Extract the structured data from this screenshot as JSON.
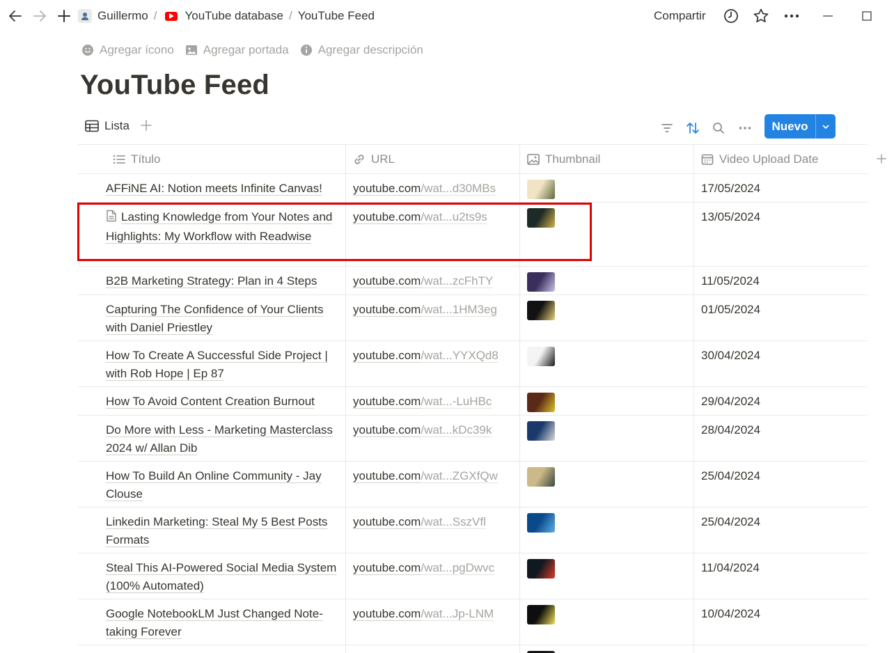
{
  "breadcrumb": {
    "user": "Guillermo",
    "sep": "/",
    "database": "YouTube database",
    "page": "YouTube Feed"
  },
  "topbar": {
    "share": "Compartir"
  },
  "page_actions": {
    "add_icon": "Agregar ícono",
    "add_cover": "Agregar portada",
    "add_description": "Agregar descripción"
  },
  "title": "YouTube Feed",
  "view": {
    "tab_label": "Lista",
    "new_label": "Nuevo"
  },
  "columns": {
    "title": "Título",
    "url": "URL",
    "thumbnail": "Thumbnail",
    "date": "Video Upload Date"
  },
  "colors": {
    "accent": "#2383e2",
    "highlight": "#e00000"
  },
  "rows": [
    {
      "title": "AFFiNE AI: Notion meets Infinite Canvas!",
      "url_main": "youtube.com",
      "url_rest": "/wat...d30MBs",
      "date": "17/05/2024",
      "thumb_a": "#f2e3c4",
      "thumb_b": "#5a6b3c"
    },
    {
      "title": "Lasting Knowledge from Your Notes and Highlights: My Workflow with Readwise",
      "url_main": "youtube.com",
      "url_rest": "/wat...u2ts9s",
      "date": "13/05/2024",
      "thumb_a": "#1e2a26",
      "thumb_b": "#d4b44a"
    },
    {
      "title": "B2B Marketing Strategy: Plan in 4 Steps",
      "url_main": "youtube.com",
      "url_rest": "/wat...zcFhTY",
      "date": "11/05/2024",
      "thumb_a": "#3a2f5c",
      "thumb_b": "#c9c4e8"
    },
    {
      "title": "Capturing The Confidence of Your Clients with Daniel Priestley",
      "url_main": "youtube.com",
      "url_rest": "/wat...1HM3eg",
      "date": "01/05/2024",
      "thumb_a": "#121212",
      "thumb_b": "#e8d27a"
    },
    {
      "title": "How To Create A Successful Side Project | with Rob Hope | Ep 87",
      "url_main": "youtube.com",
      "url_rest": "/wat...YYXQd8",
      "date": "30/04/2024",
      "thumb_a": "#f4f4f4",
      "thumb_b": "#1a1a1a"
    },
    {
      "title": "How To Avoid Content Creation Burnout",
      "url_main": "youtube.com",
      "url_rest": "/wat...-LuHBc",
      "date": "29/04/2024",
      "thumb_a": "#5a2a18",
      "thumb_b": "#e0c02a"
    },
    {
      "title": "Do More with Less - Marketing Masterclass 2024 w/ Allan Dib",
      "url_main": "youtube.com",
      "url_rest": "/wat...kDc39k",
      "date": "28/04/2024",
      "thumb_a": "#1b3a6b",
      "thumb_b": "#d9d9d9"
    },
    {
      "title": "How To Build An Online Community - Jay Clouse",
      "url_main": "youtube.com",
      "url_rest": "/wat...ZGXfQw",
      "date": "25/04/2024",
      "thumb_a": "#cbb98a",
      "thumb_b": "#3b4a3a"
    },
    {
      "title": "Linkedin Marketing: Steal My 5 Best Posts Formats",
      "url_main": "youtube.com",
      "url_rest": "/wat...SszVfl",
      "date": "25/04/2024",
      "thumb_a": "#0a4a8a",
      "thumb_b": "#5fb0e8"
    },
    {
      "title": "Steal This AI-Powered Social Media System (100% Automated)",
      "url_main": "youtube.com",
      "url_rest": "/wat...pgDwvc",
      "date": "11/04/2024",
      "thumb_a": "#101820",
      "thumb_b": "#e03a2a"
    },
    {
      "title": "Google NotebookLM Just Changed Note-taking Forever",
      "url_main": "youtube.com",
      "url_rest": "/wat...Jp-LNM",
      "date": "10/04/2024",
      "thumb_a": "#0e0e0e",
      "thumb_b": "#f0e05a"
    },
    {
      "title": "",
      "url_main": "",
      "url_rest": "",
      "date": "",
      "thumb_a": "#111111",
      "thumb_b": "#333333"
    }
  ]
}
